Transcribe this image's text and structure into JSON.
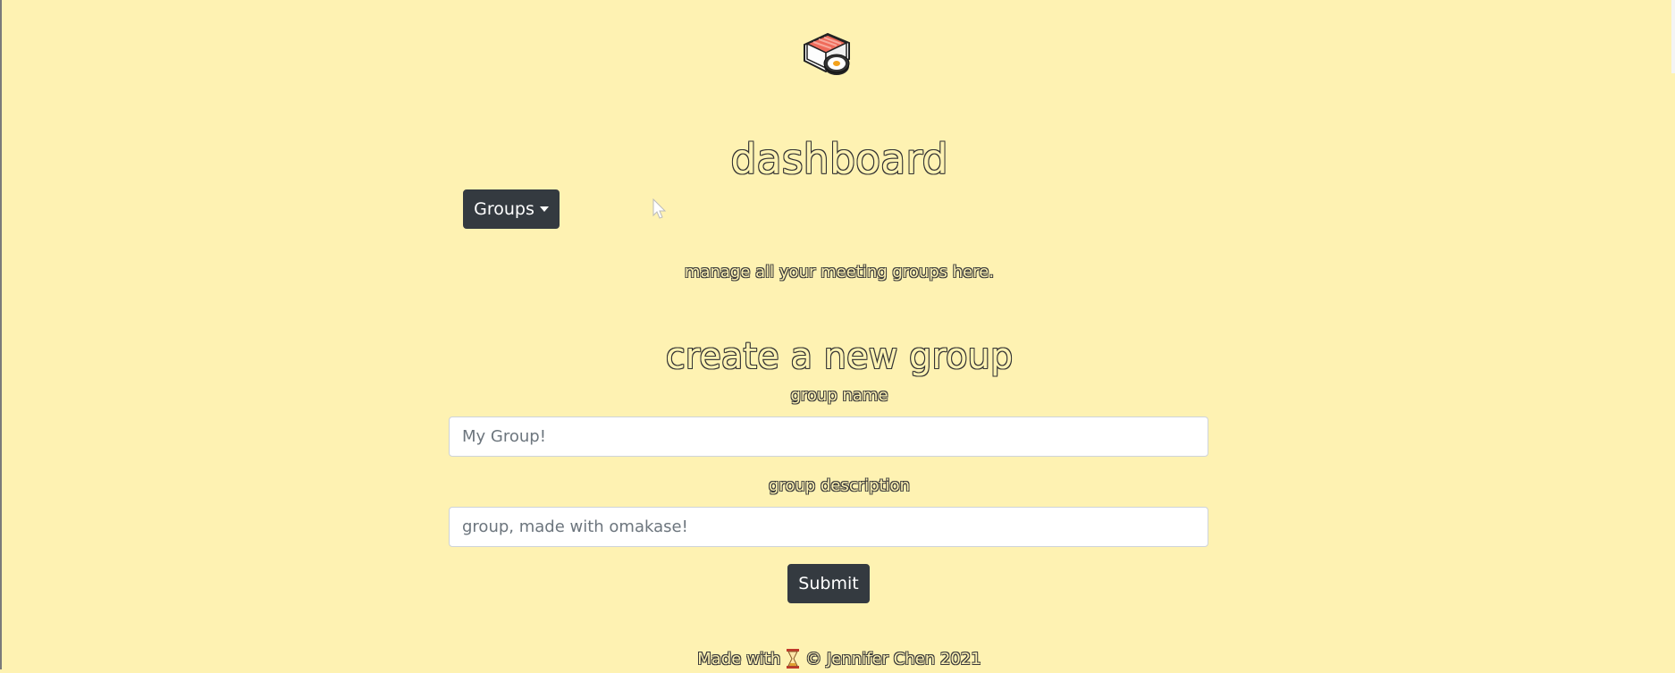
{
  "page": {
    "title": "dashboard",
    "subtitle": "manage all your meeting groups here.",
    "logo_icon": "sushi-icon"
  },
  "groups_menu": {
    "label": "Groups"
  },
  "create_group": {
    "title": "create a new group",
    "name_label": "group name",
    "name_placeholder": "My Group!",
    "description_label": "group description",
    "description_placeholder": "group, made with omakase!",
    "submit_label": "Submit"
  },
  "footer": {
    "prefix": "Made with",
    "icon": "hourglass-icon",
    "suffix": "© Jennifer Chen 2021"
  },
  "colors": {
    "background": "#fef2b2",
    "button": "#343a40",
    "accent_red": "#ef6a5a"
  }
}
